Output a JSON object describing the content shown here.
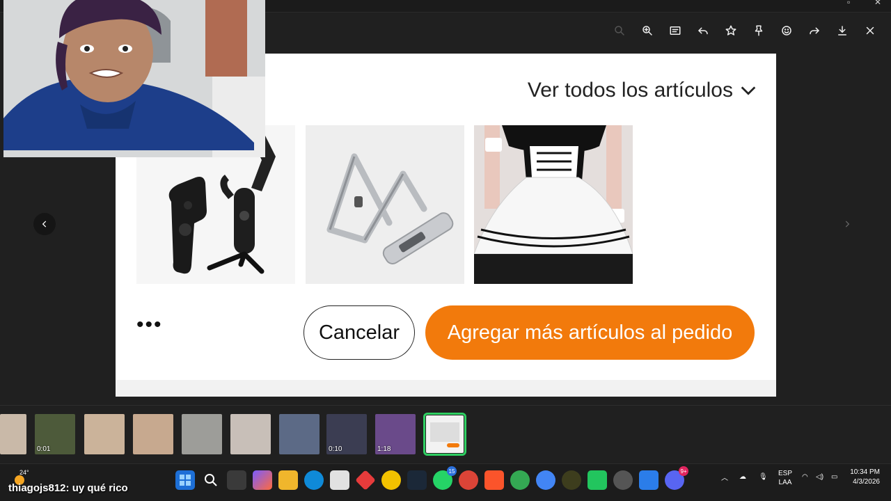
{
  "toolbar": {
    "icons": [
      "zoom-out-icon",
      "zoom-in-icon",
      "slideshow-icon",
      "reply-icon",
      "star-icon",
      "pin-icon",
      "emoji-icon",
      "forward-icon",
      "download-icon",
      "close-icon"
    ]
  },
  "viewer": {
    "view_all_label": "Ver todos los artículos",
    "more_label": "•••",
    "cancel_label": "Cancelar",
    "add_label": "Agregar más artículos al pedido",
    "accent_color": "#f27a0c"
  },
  "filmstrip": {
    "items": [
      {
        "duration": ""
      },
      {
        "duration": "0:01"
      },
      {
        "duration": ""
      },
      {
        "duration": ""
      },
      {
        "duration": ""
      },
      {
        "duration": ""
      },
      {
        "duration": ""
      },
      {
        "duration": "0:10"
      },
      {
        "duration": "1:18"
      },
      {
        "duration": ""
      }
    ],
    "selected_index": 9
  },
  "taskbar": {
    "weather": "24°",
    "chat_user": "thiagojs812",
    "chat_message": ": uy qué rico",
    "whatsapp_badge": "15",
    "discord_badge": "9+",
    "language": "ESP",
    "layout": "LAA",
    "time": "10:34 PM",
    "date": "4/3/2026"
  }
}
